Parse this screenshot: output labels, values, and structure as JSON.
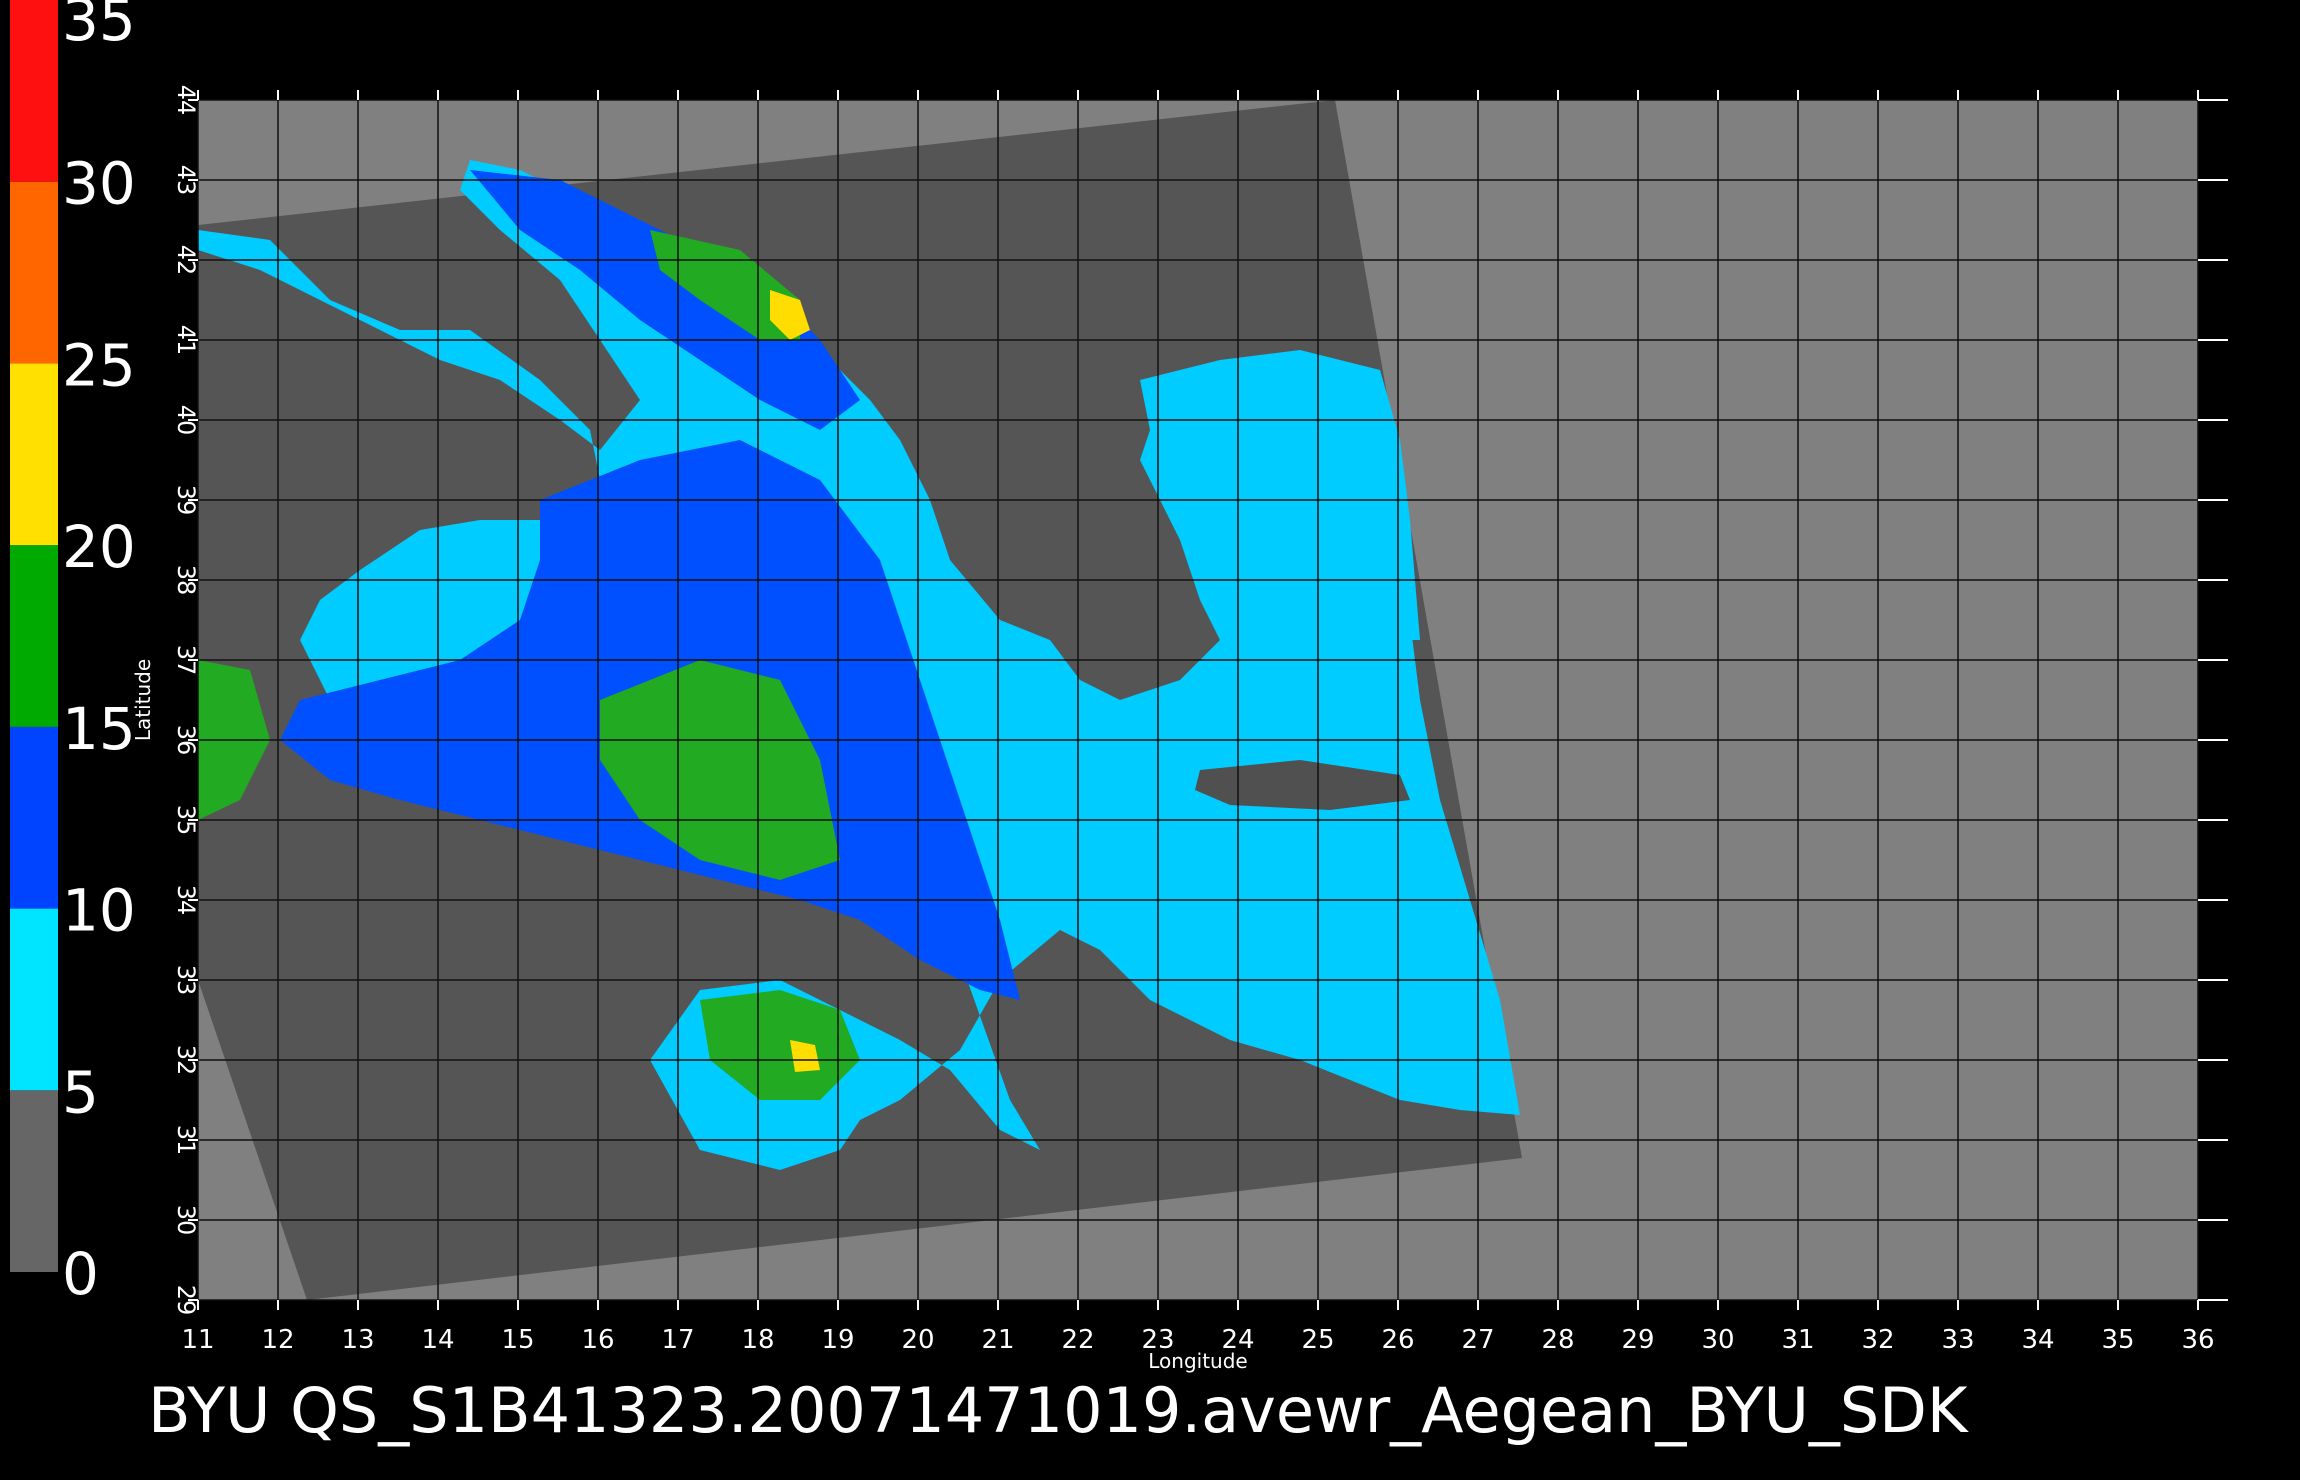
{
  "chart_data": {
    "type": "heatmap",
    "title": "BYU QS_S1B41323.20071471019.avewr_Aegean_BYU_SDK",
    "xlabel": "Longitude",
    "ylabel": "Latitude",
    "xlim": [
      11,
      36
    ],
    "ylim": [
      29,
      44
    ],
    "x_ticks": [
      "11",
      "12",
      "13",
      "14",
      "15",
      "16",
      "17",
      "18",
      "19",
      "20",
      "21",
      "22",
      "23",
      "24",
      "25",
      "26",
      "27",
      "28",
      "29",
      "30",
      "31",
      "32",
      "33",
      "34",
      "35",
      "36"
    ],
    "y_ticks": [
      "29",
      "30",
      "31",
      "32",
      "33",
      "34",
      "35",
      "36",
      "37",
      "38",
      "39",
      "40",
      "41",
      "42",
      "43",
      "44"
    ],
    "grid": true,
    "colorbar": {
      "range": [
        0,
        35
      ],
      "tick_labels": [
        "0",
        "5",
        "10",
        "15",
        "20",
        "25",
        "30",
        "35"
      ],
      "bands": [
        {
          "from": 0,
          "to": 5,
          "color": "#666666"
        },
        {
          "from": 5,
          "to": 10,
          "color": "#00e5ff"
        },
        {
          "from": 10,
          "to": 15,
          "color": "#0044ff"
        },
        {
          "from": 15,
          "to": 20,
          "color": "#00aa00"
        },
        {
          "from": 20,
          "to": 25,
          "color": "#ffe000"
        },
        {
          "from": 25,
          "to": 30,
          "color": "#ff6600"
        },
        {
          "from": 30,
          "to": 35,
          "color": "#ff1010"
        }
      ]
    },
    "colors": {
      "swath_bg": "#555555",
      "outside_bg": "#808080",
      "land": "#505050"
    }
  }
}
